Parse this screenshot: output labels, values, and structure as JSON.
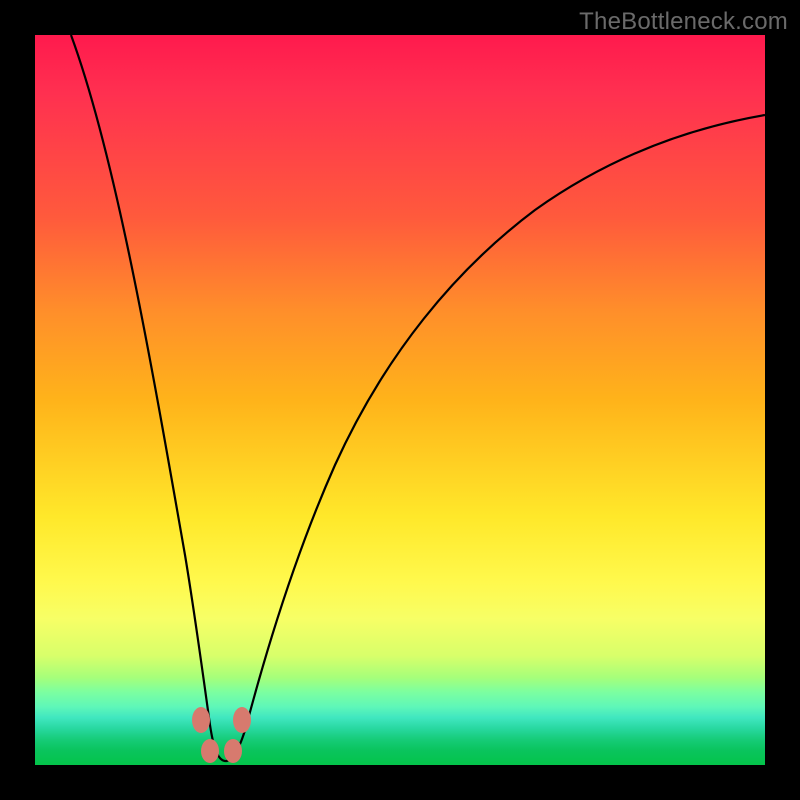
{
  "watermark": "TheBottleneck.com",
  "chart_data": {
    "type": "line",
    "title": "",
    "xlabel": "",
    "ylabel": "",
    "xlim": [
      0,
      100
    ],
    "ylim": [
      0,
      100
    ],
    "series": [
      {
        "name": "bottleneck-curve",
        "x": [
          5,
          10,
          15,
          18,
          20,
          22,
          23,
          24,
          25,
          26,
          27,
          28,
          30,
          33,
          37,
          42,
          48,
          55,
          63,
          72,
          82,
          92,
          100
        ],
        "y": [
          100,
          70,
          40,
          24,
          14,
          7,
          4,
          1.5,
          0.5,
          0.5,
          1.5,
          4,
          10,
          20,
          33,
          46,
          57,
          66,
          74,
          80,
          84,
          87,
          89
        ]
      }
    ],
    "markers": [
      {
        "x": 22.5,
        "y": 6
      },
      {
        "x": 23.5,
        "y": 2
      },
      {
        "x": 26.5,
        "y": 2
      },
      {
        "x": 27.5,
        "y": 6
      }
    ],
    "background_gradient": {
      "top": "#ff1a4d",
      "mid": "#ffe82a",
      "bottom": "#04c44a"
    }
  }
}
